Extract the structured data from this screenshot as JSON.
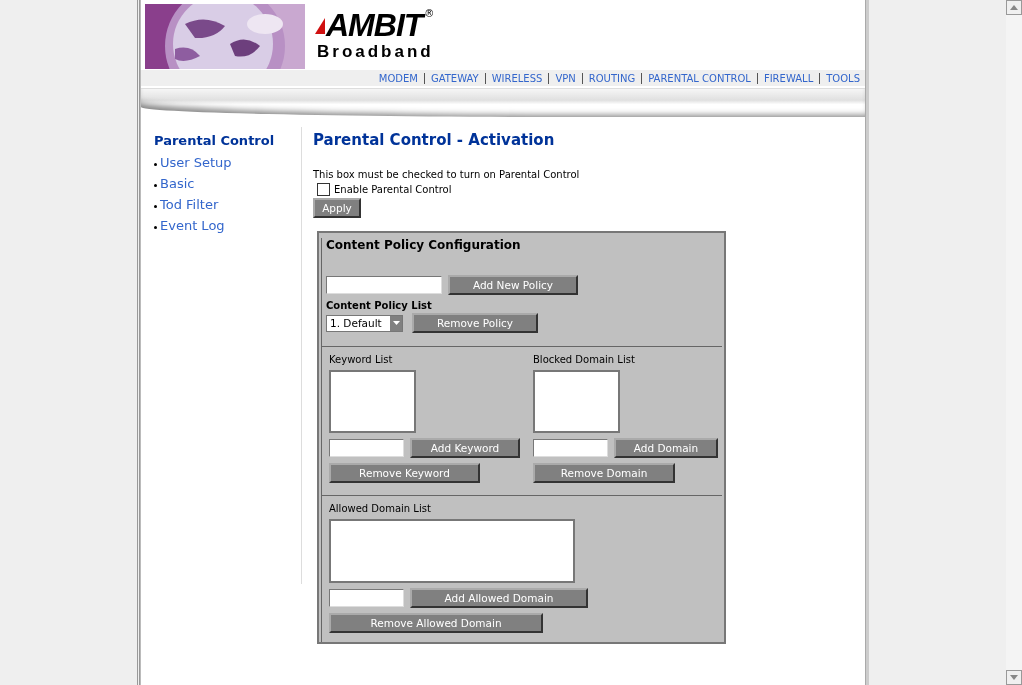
{
  "header": {
    "logo": {
      "brand": "AMBIT",
      "mark": "®",
      "tagline": "Broadband"
    },
    "nav": [
      {
        "label": "MODEM"
      },
      {
        "label": "GATEWAY"
      },
      {
        "label": "WIRELESS"
      },
      {
        "label": "VPN"
      },
      {
        "label": "ROUTING"
      },
      {
        "label": "PARENTAL CONTROL"
      },
      {
        "label": "FIREWALL"
      },
      {
        "label": "TOOLS"
      }
    ]
  },
  "sidebar": {
    "title": "Parental Control",
    "items": [
      {
        "label": "User Setup"
      },
      {
        "label": "Basic"
      },
      {
        "label": "Tod Filter"
      },
      {
        "label": "Event Log"
      }
    ]
  },
  "main": {
    "title": "Parental Control - Activation",
    "note": "This box must be checked to turn on Parental Control",
    "enable": {
      "label": "Enable Parental Control",
      "checked": false
    },
    "apply_button": "Apply",
    "policy": {
      "title": "Content Policy Configuration",
      "add_button": "Add New Policy",
      "list_label": "Content Policy List",
      "select_value": "1. Default",
      "remove_button": "Remove Policy"
    },
    "keyword": {
      "label": "Keyword List",
      "add_button": "Add Keyword",
      "remove_button": "Remove Keyword"
    },
    "blocked": {
      "label": "Blocked Domain List",
      "add_button": "Add Domain",
      "remove_button": "Remove Domain"
    },
    "allowed": {
      "label": "Allowed Domain List",
      "add_button": "Add Allowed Domain",
      "remove_button": "Remove Allowed Domain"
    }
  }
}
